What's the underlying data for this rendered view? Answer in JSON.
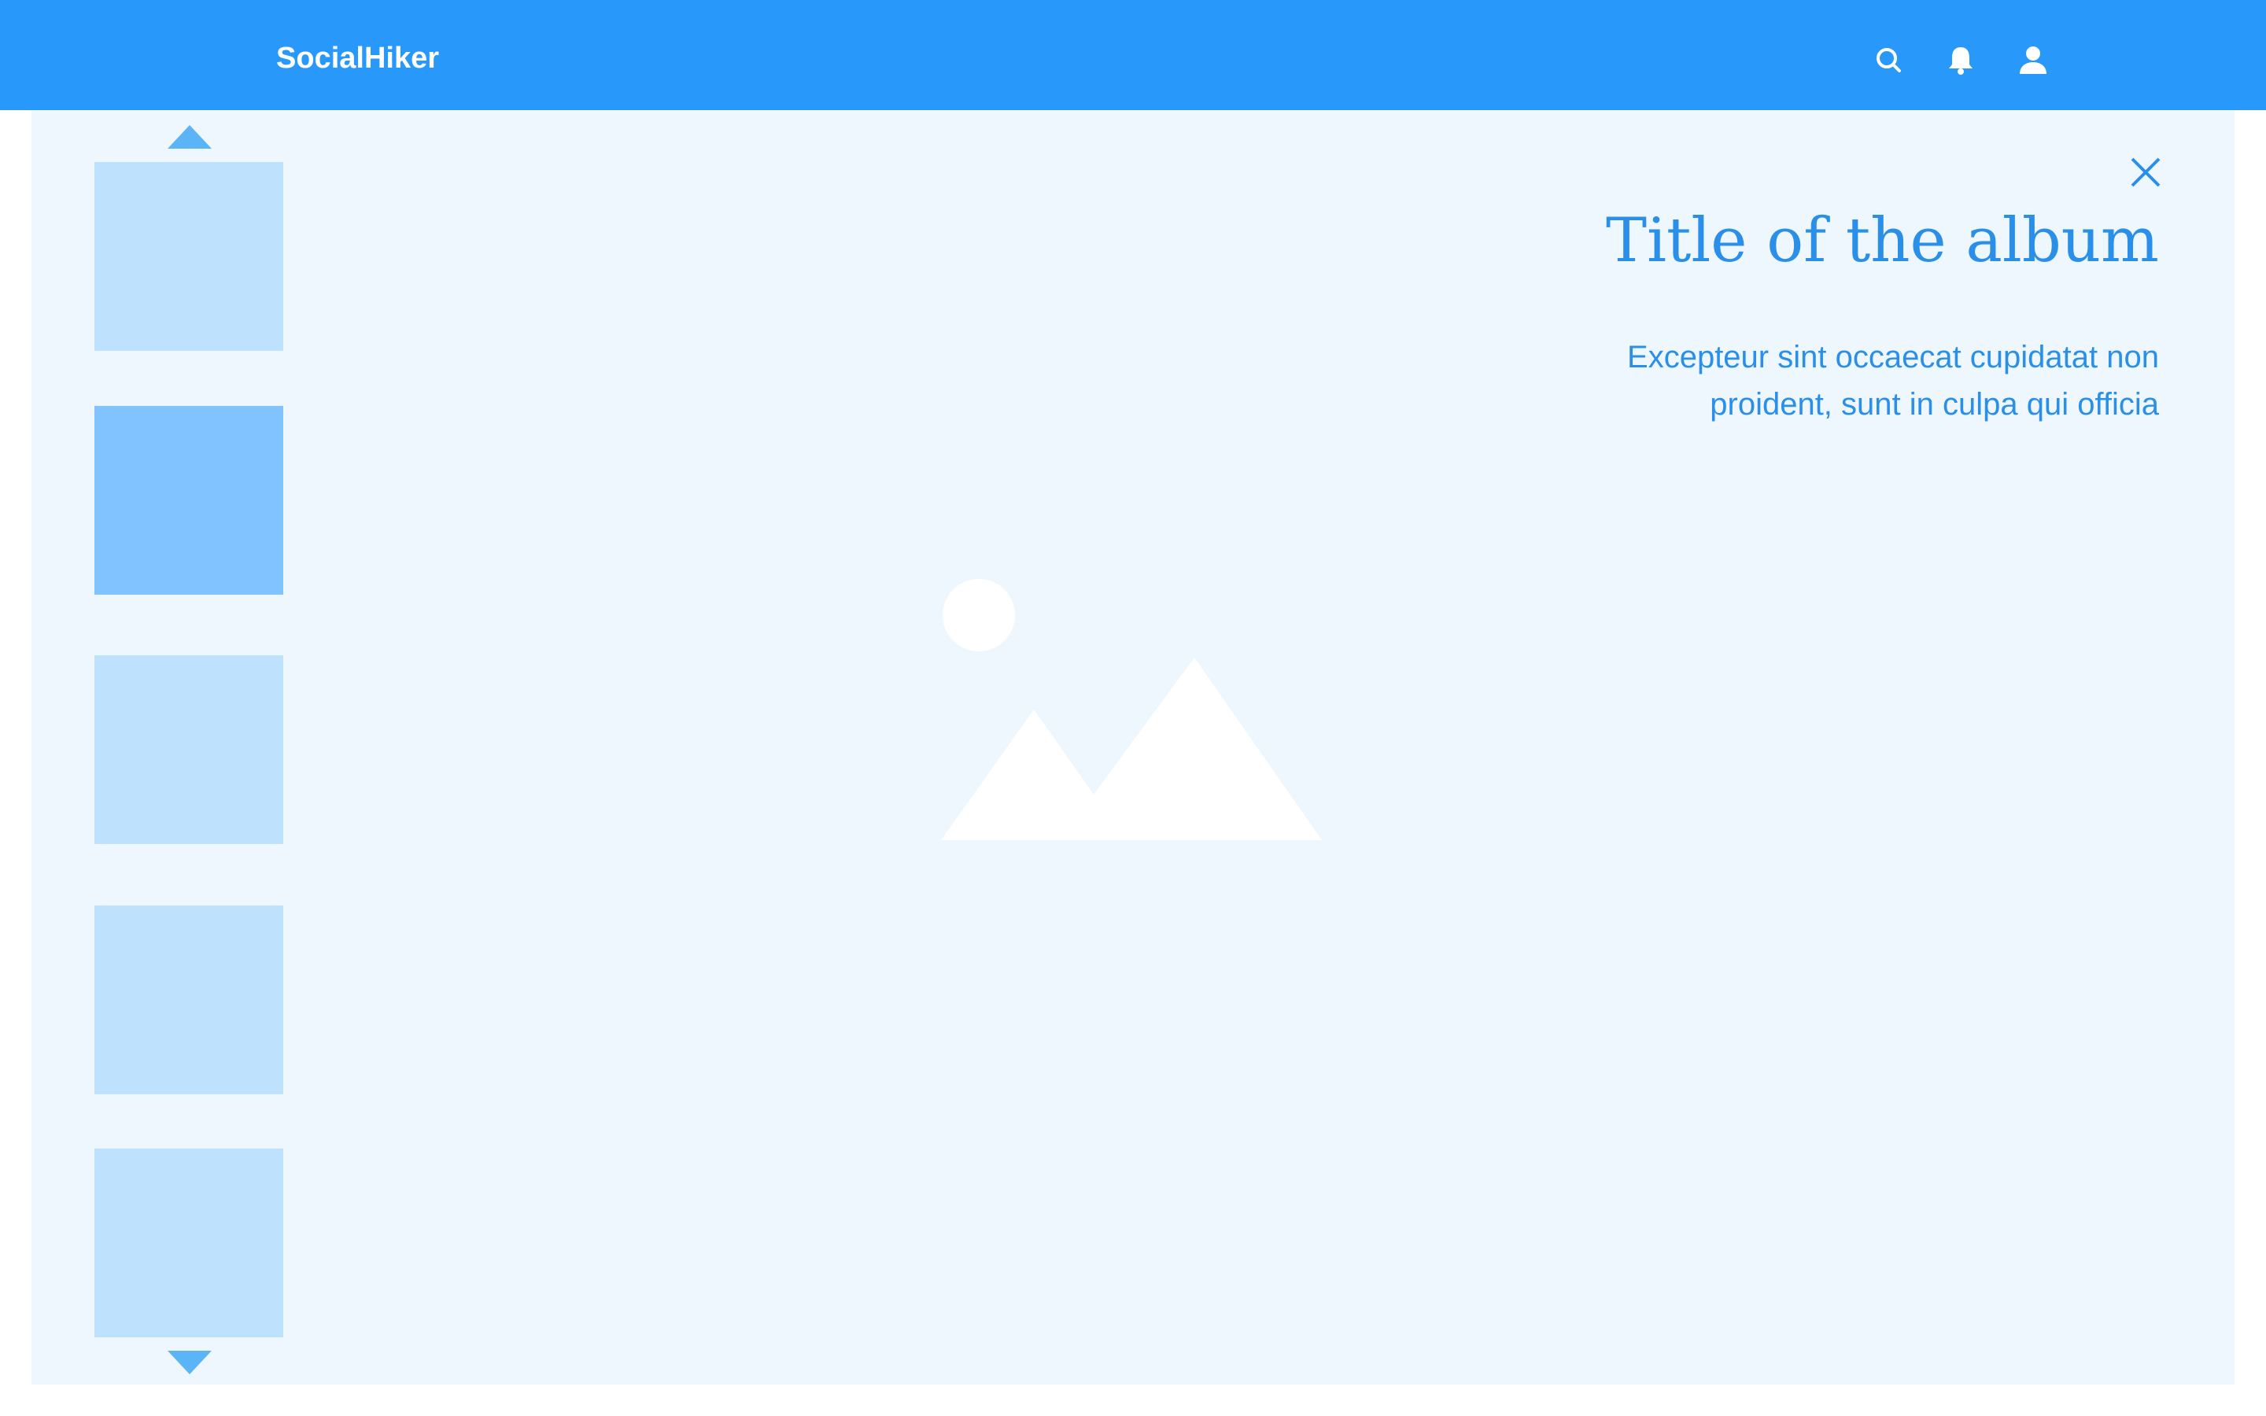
{
  "header": {
    "brand": "SocialHiker",
    "icons": [
      "search-icon",
      "bell-icon",
      "user-icon"
    ],
    "background_color": "#2899fb"
  },
  "gallery": {
    "nav_icons": [
      "chevron-up-icon",
      "chevron-down-icon"
    ],
    "thumbnails": [
      {
        "state": "default"
      },
      {
        "state": "selected"
      },
      {
        "state": "default"
      },
      {
        "state": "default"
      },
      {
        "state": "default"
      }
    ],
    "main_image_icon": "image-placeholder-icon"
  },
  "album": {
    "title": "Title of the album",
    "description": "Excepteur sint occaecat cupidatat non proident, sunt in culpa qui officia",
    "close_icon": "close-icon"
  },
  "colors": {
    "accent": "#2899fb",
    "text_accent": "#2a8fe8",
    "panel_bg": "#eff7fe",
    "thumb": "#bee1fd",
    "thumb_selected": "#80c3fe",
    "arrow": "#5ab4f5"
  }
}
